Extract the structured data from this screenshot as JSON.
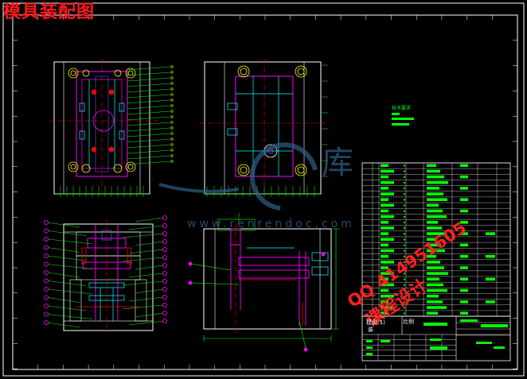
{
  "drawing": {
    "title": "模具装配图",
    "watermark_cn": "库",
    "watermark_url": "www.renrendoc.com",
    "watermark_qq": "QQ 414951605",
    "watermark_service": "课程设计",
    "title_block": {
      "part_name": "模具(1)",
      "sub_name": "装",
      "scale_label": "比例"
    },
    "legend_title": "技术要求"
  },
  "colors": {
    "background": "#000000",
    "frame": "#ffffff",
    "green": "#00ff00",
    "magenta": "#ff00ff",
    "cyan": "#00ffff",
    "red": "#ff0000",
    "yellow": "#ffff00",
    "blue": "#5a5aff"
  }
}
